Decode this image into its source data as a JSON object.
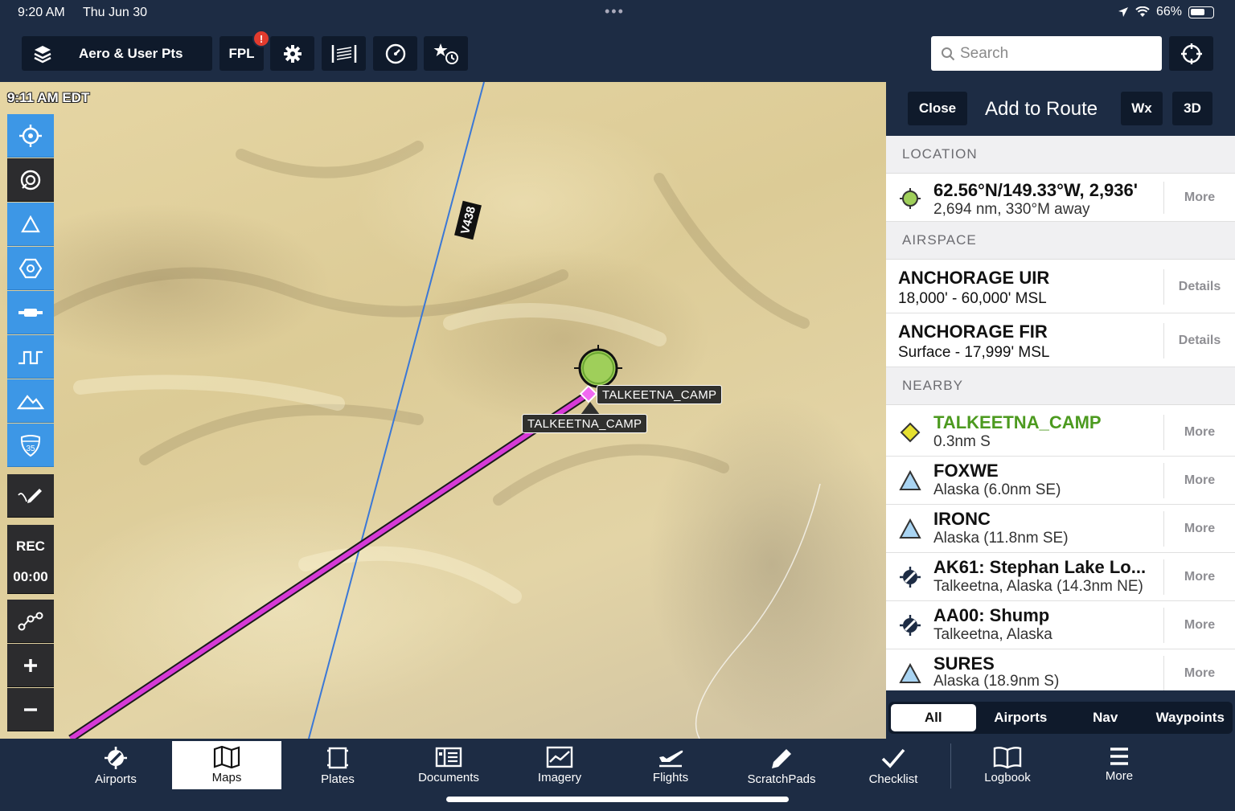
{
  "status": {
    "time": "9:20 AM",
    "date": "Thu Jun 30",
    "battery": "66%",
    "battery_level": 0.66
  },
  "toolbar": {
    "layers_label": "Aero & User Pts",
    "fpl_label": "FPL",
    "fpl_badge": "!",
    "search_placeholder": "Search"
  },
  "map": {
    "time": "9:11 AM EDT",
    "airway": "V438",
    "waypoint_label": "TALKEETNA_CAMP",
    "waypoint_label_2": "TALKEETNA_CAMP"
  },
  "left_controls": {
    "rec": "REC",
    "timer": "00:00"
  },
  "panel": {
    "close": "Close",
    "title": "Add to Route",
    "wx": "Wx",
    "three_d": "3D",
    "sections": {
      "location": "LOCATION",
      "airspace": "AIRSPACE",
      "nearby": "NEARBY"
    },
    "location": {
      "coords": "62.56°N/149.33°W, 2,936'",
      "distance": "2,694 nm, 330°M away",
      "action": "More"
    },
    "airspace": [
      {
        "name": "ANCHORAGE UIR",
        "range": "18,000' - 60,000' MSL",
        "action": "Details"
      },
      {
        "name": "ANCHORAGE FIR",
        "range": "Surface - 17,999' MSL",
        "action": "Details"
      }
    ],
    "nearby": [
      {
        "name": "TALKEETNA_CAMP",
        "detail": "0.3nm S",
        "action": "More",
        "icon": "user-waypoint-diamond-icon"
      },
      {
        "name": "FOXWE",
        "detail": "Alaska  (6.0nm SE)",
        "action": "More",
        "icon": "fix-triangle-icon"
      },
      {
        "name": "IRONC",
        "detail": "Alaska  (11.8nm SE)",
        "action": "More",
        "icon": "fix-triangle-icon"
      },
      {
        "name": "AK61: Stephan Lake Lo...",
        "detail": "Talkeetna, Alaska  (14.3nm NE)",
        "action": "More",
        "icon": "airport-icon"
      },
      {
        "name": "AA00: Shump",
        "detail": "Talkeetna, Alaska",
        "action": "More",
        "icon": "airport-icon"
      },
      {
        "name": "SURES",
        "detail": "Alaska  (18.9nm S)",
        "action": "More",
        "icon": "fix-triangle-icon"
      }
    ],
    "filters": [
      "All",
      "Airports",
      "Nav",
      "Waypoints"
    ],
    "colors": {
      "highlight_green": "#4c9a1f",
      "accent_blue": "#3d97e6",
      "route_magenta": "#d63ad6"
    }
  },
  "tabs": [
    {
      "label": "Airports",
      "icon": "airport-icon"
    },
    {
      "label": "Maps",
      "icon": "map-icon",
      "active": true
    },
    {
      "label": "Plates",
      "icon": "plates-icon"
    },
    {
      "label": "Documents",
      "icon": "documents-icon"
    },
    {
      "label": "Imagery",
      "icon": "imagery-icon"
    },
    {
      "label": "Flights",
      "icon": "flights-icon"
    },
    {
      "label": "ScratchPads",
      "icon": "pencil-icon"
    },
    {
      "label": "Checklist",
      "icon": "checkmark-icon"
    },
    {
      "label": "Logbook",
      "icon": "logbook-icon"
    },
    {
      "label": "More",
      "icon": "menu-icon"
    }
  ]
}
